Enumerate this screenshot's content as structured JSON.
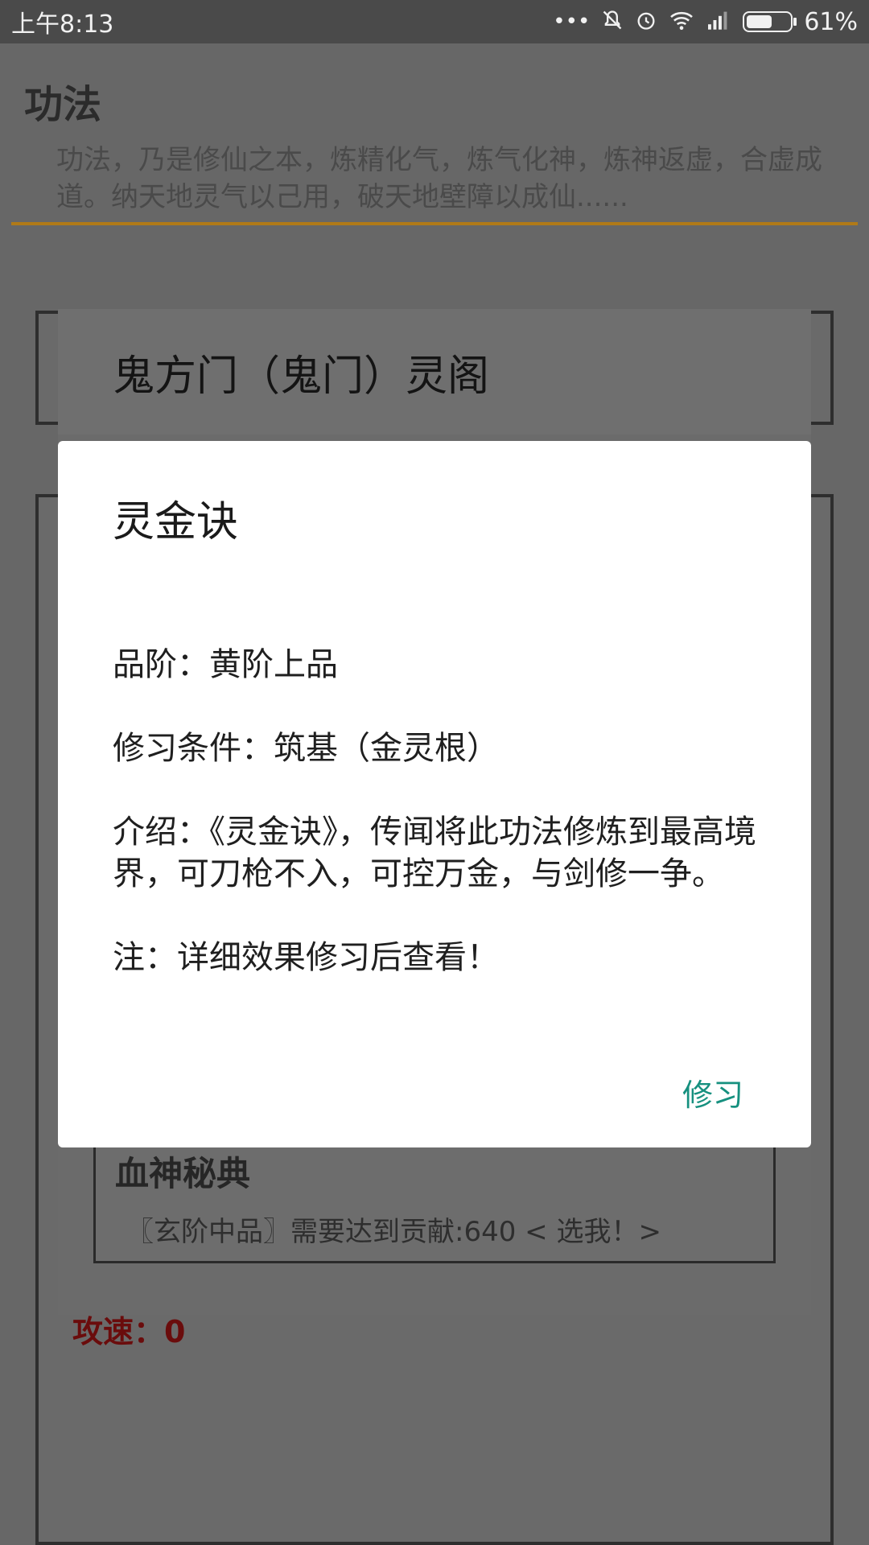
{
  "status_bar": {
    "time": "上午8:13",
    "battery_percent": "61%",
    "battery_level": 0.61,
    "icons": [
      "more-dots-icon",
      "bell-muted-icon",
      "alarm-icon",
      "wifi-icon",
      "signal-icon",
      "battery-icon"
    ]
  },
  "page": {
    "title": "功法",
    "description": "功法，乃是修仙之本，炼精化气，炼气化神，炼神返虚，合虚成道。纳天地灵气以己用，破天地壁障以成仙......",
    "accent_color": "#b07a18"
  },
  "list": {
    "header": "鬼方门（鬼门）灵阁",
    "item": {
      "title": "血神秘典",
      "subtitle": "〖玄阶中品〗需要达到贡献:640  < 选我！>"
    }
  },
  "stats": {
    "attack_speed": "攻速：0"
  },
  "dialog": {
    "title": "灵金诀",
    "lines": [
      "品阶：黄阶上品",
      "修习条件：筑基（金灵根）",
      "介绍：《灵金诀》，传闻将此功法修炼到最高境界，可刀枪不入，可控万金，与剑修一争。",
      "注：详细效果修习后查看！"
    ],
    "action_label": "修习",
    "action_color": "#16907f"
  }
}
